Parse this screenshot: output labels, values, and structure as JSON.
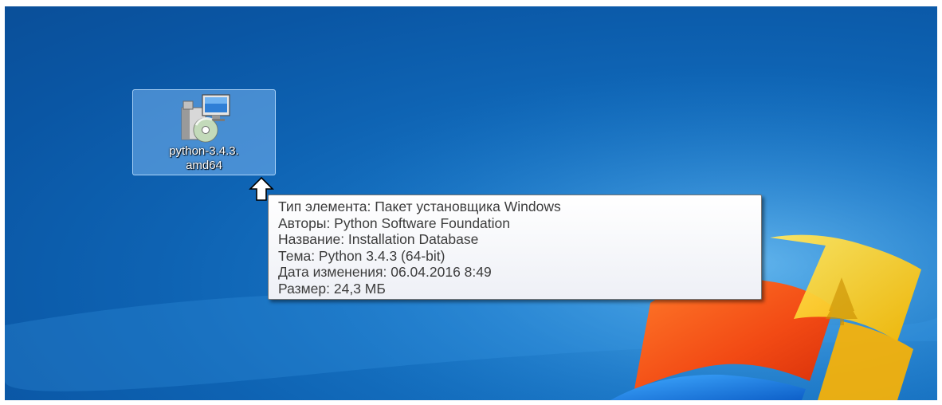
{
  "desktop": {
    "icon": {
      "label_line1": "python-3.4.3.",
      "label_line2": "amd64",
      "icon_name": "windows-installer-package-icon"
    },
    "tooltip": {
      "lines": [
        "Тип элемента: Пакет установщика Windows",
        "Авторы: Python Software Foundation",
        "Название: Installation Database",
        "Тема: Python 3.4.3 (64-bit)",
        "Дата изменения: 06.04.2016 8:49",
        "Размер: 24,3 МБ"
      ]
    },
    "cursor": {
      "icon_name": "mouse-pointer-icon"
    }
  },
  "colors": {
    "wallpaper_blue": "#0e63b3",
    "selection_highlight": "#78b4f0",
    "tooltip_text": "#3c3c3c",
    "tooltip_border": "#767676"
  }
}
